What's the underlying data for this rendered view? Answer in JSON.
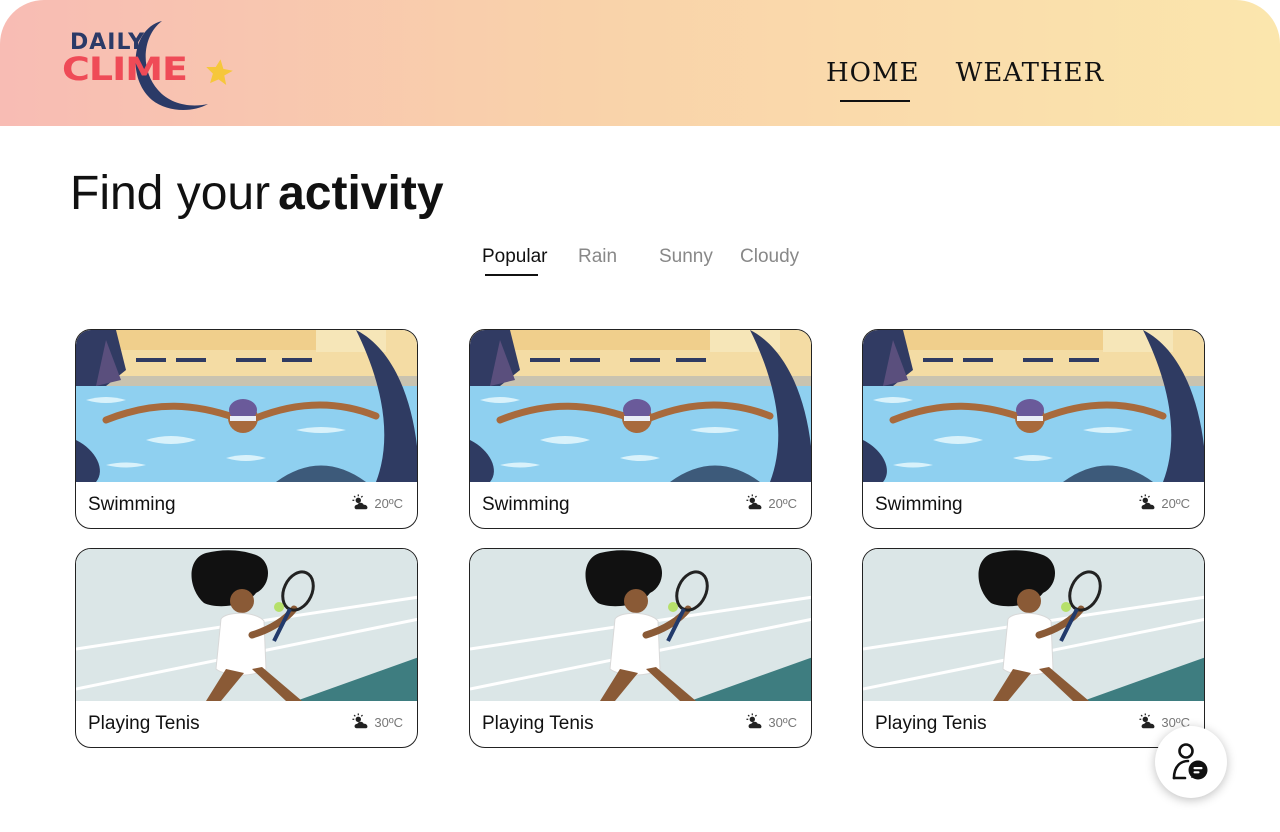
{
  "brand": {
    "logo_top": "DAILY",
    "logo_bottom": "CLIME",
    "colors": {
      "navy": "#2b3a67",
      "red": "#ef4b57",
      "star": "#f6c73b"
    }
  },
  "nav": {
    "items": [
      {
        "label": "HOME",
        "active": true
      },
      {
        "label": "WEATHER",
        "active": false
      }
    ]
  },
  "main": {
    "title_light": "Find your",
    "title_bold": "activity",
    "filters": [
      {
        "label": "Popular",
        "active": true
      },
      {
        "label": "Rain",
        "active": false
      },
      {
        "label": "Sunny",
        "active": false
      },
      {
        "label": "Cloudy",
        "active": false
      }
    ],
    "cards": [
      {
        "title": "Swimming",
        "temp": "20ºC",
        "image": "swimming-illustration",
        "weather_icon": "partly-cloudy-icon"
      },
      {
        "title": "Swimming",
        "temp": "20ºC",
        "image": "swimming-illustration",
        "weather_icon": "partly-cloudy-icon"
      },
      {
        "title": "Swimming",
        "temp": "20ºC",
        "image": "swimming-illustration",
        "weather_icon": "partly-cloudy-icon"
      },
      {
        "title": "Playing Tenis",
        "temp": "30ºC",
        "image": "tennis-illustration",
        "weather_icon": "partly-cloudy-icon"
      },
      {
        "title": "Playing Tenis",
        "temp": "30ºC",
        "image": "tennis-illustration",
        "weather_icon": "partly-cloudy-icon"
      },
      {
        "title": "Playing Tenis",
        "temp": "30ºC",
        "image": "tennis-illustration",
        "weather_icon": "partly-cloudy-icon"
      }
    ]
  },
  "fab": {
    "icon": "user-chat-icon"
  },
  "theme": {
    "header_gradient": [
      "#f8bcb4",
      "#fbe6ad"
    ],
    "pool_blue": "#8fd0f0",
    "court_teal": "#3e7d80"
  }
}
